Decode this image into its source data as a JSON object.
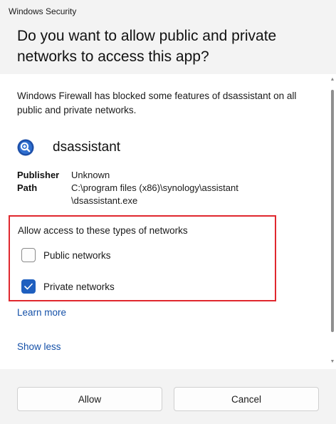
{
  "window": {
    "title": "Windows Security",
    "question": "Do you want to allow public and private networks to access this app?"
  },
  "content": {
    "description": "Windows Firewall has blocked some features of dsassistant on all public and private networks.",
    "app": {
      "name": "dsassistant",
      "icon": "synology-assistant-icon"
    },
    "publisher": {
      "label": "Publisher",
      "value": "Unknown"
    },
    "path": {
      "label": "Path",
      "value": "C:\\program files (x86)\\synology\\assistant \\dsassistant.exe"
    },
    "networks": {
      "title": "Allow access to these types of networks",
      "options": [
        {
          "label": "Public networks",
          "checked": false
        },
        {
          "label": "Private networks",
          "checked": true
        }
      ]
    },
    "learn_more": "Learn more",
    "show_less": "Show less"
  },
  "footer": {
    "allow": "Allow",
    "cancel": "Cancel"
  },
  "colors": {
    "accent": "#1f5fbf",
    "link": "#1450a8",
    "highlight": "#e0282e"
  }
}
